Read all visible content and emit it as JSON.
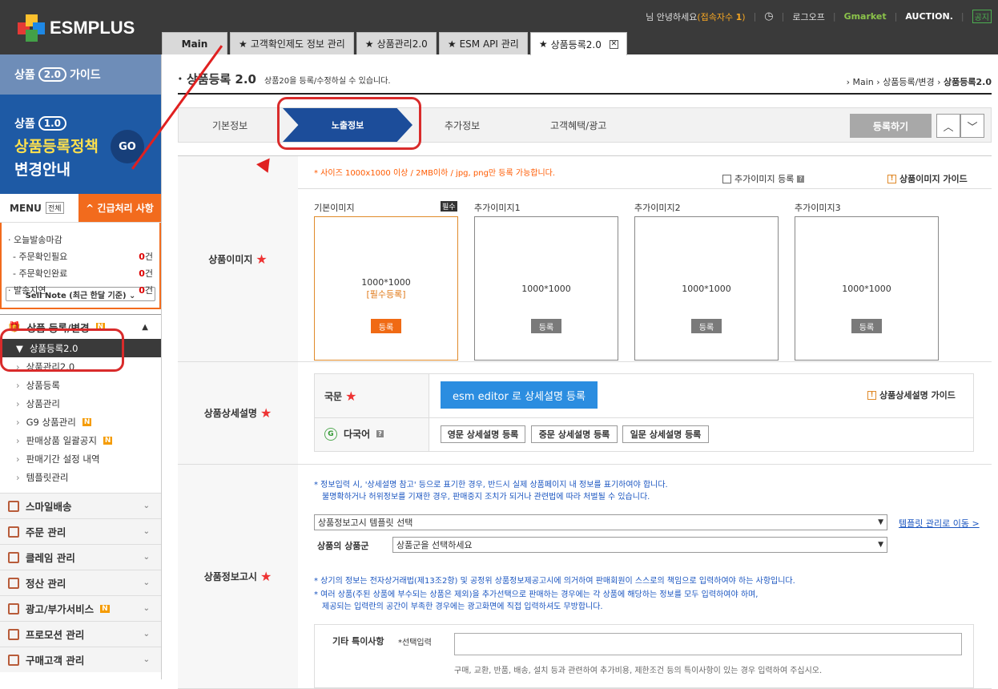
{
  "topbar": {
    "logo_text": "ESMPLUS",
    "greeting": "님 안녕하세요",
    "conn_label": "(접속자수",
    "conn_count": "1",
    "conn_close": ")",
    "logout": "로그오프",
    "gmarket": "Gmarket",
    "auction": "AUCTION.",
    "notice": "공지"
  },
  "tabs": [
    {
      "label": "Main"
    },
    {
      "label": "고객확인제도 정보 관리"
    },
    {
      "label": "상품관리2.0"
    },
    {
      "label": "ESM API 관리"
    },
    {
      "label": "상품등록2.0"
    }
  ],
  "sidebar": {
    "guide_prefix": "상품",
    "guide_version": "2.0",
    "guide_suffix": "가이드",
    "policy_prefix": "상품",
    "policy_version": "1.0",
    "policy_line2": "상품등록정책",
    "policy_line3": "변경안내",
    "go": "GO",
    "menu": "MENU",
    "all": "전체",
    "urgent": "^ 긴급처리 사항",
    "stats": [
      {
        "label": "· 오늘발송마감",
        "value": "",
        "unit": ""
      },
      {
        "label": "  - 주문확인필요",
        "value": "0",
        "unit": "건"
      },
      {
        "label": "  - 주문확인완료",
        "value": "0",
        "unit": "건"
      },
      {
        "label": "· 발송지연",
        "value": "0",
        "unit": "건"
      }
    ],
    "sellnote": "Sell Note (최근 한달 기준) ⌄",
    "section_title": "상품 등록/변경",
    "new_badge": "N",
    "items": [
      {
        "label": "상품등록2.0"
      },
      {
        "label": "상품관리2.0"
      },
      {
        "label": "상품등록"
      },
      {
        "label": "상품관리"
      },
      {
        "label": "G9 상품관리"
      },
      {
        "label": "판매상품 일괄공지"
      },
      {
        "label": "판매기간 설정 내역"
      },
      {
        "label": "템플릿관리"
      }
    ],
    "cats": [
      {
        "label": "스마일배송"
      },
      {
        "label": "주문 관리"
      },
      {
        "label": "클레임 관리"
      },
      {
        "label": "정산 관리"
      },
      {
        "label": "광고/부가서비스"
      },
      {
        "label": "프로모션 관리"
      },
      {
        "label": "구매고객 관리"
      }
    ]
  },
  "page": {
    "title": "상품등록 2.0",
    "desc": "상품20을 등록/수정하실 수 있습니다.",
    "bread1": "Main",
    "bread2": "상품등록/변경",
    "bread3": "상품등록2.0",
    "steps": [
      "기본정보",
      "노출정보",
      "추가정보",
      "고객혜택/광고"
    ],
    "register": "등록하기"
  },
  "image_section": {
    "label": "상품이미지",
    "note": "* 사이즈 1000x1000 이상 / 2MB이하 / jpg, png만 등록 가능합니다.",
    "add_check": "추가이미지 등록",
    "guide": "상품이미지 가이드",
    "boxes": [
      {
        "title": "기본이미지",
        "size": "1000*1000",
        "req": "[필수등록]",
        "btn": "등록",
        "badge": "필수"
      },
      {
        "title": "추가이미지1",
        "size": "1000*1000",
        "btn": "등록"
      },
      {
        "title": "추가이미지2",
        "size": "1000*1000",
        "btn": "등록"
      },
      {
        "title": "추가이미지3",
        "size": "1000*1000",
        "btn": "등록"
      }
    ]
  },
  "detail_section": {
    "label": "상품상세설명",
    "domestic": "국문",
    "editor_btn": "esm editor 로 상세설명 등록",
    "guide": "상품상세설명 가이드",
    "multi": "다국어",
    "en": "영문 상세설명 등록",
    "cn": "중문 상세설명 등록",
    "jp": "일문 상세설명 등록"
  },
  "notice_section": {
    "label": "상품정보고시",
    "note1": "* 정보입력 시, '상세설명 참고' 등으로 표기한 경우, 반드시 실제 상품페이지 내 정보를 표기하여야 합니다.",
    "note2": "불명확하거나 허위정보를 기재한 경우, 판매중지 조치가 되거나 관련법에 따라 처벌될 수 있습니다.",
    "template_select": "상품정보고시 템플릿 선택",
    "template_link": "템플릿 관리로 이동 >",
    "group_label": "상품의 상품군",
    "group_select": "상품군을 선택하세요",
    "note3": "* 상기의 정보는 전자상거래법(제13조2항) 및 공정위 상품정보제공고시에 의거하여 판매회원이 스스로의 책임으로 입력하여야 하는 사항입니다.",
    "note4": "* 여러 상품(주된 상품에 부수되는 상품은 제외)을 추가선택으로 판매하는 경우에는 각 상품에 해당하는 정보를 모두 입력하여야 하며,",
    "note5": "제공되는 입력란의 공간이 부족한 경우에는 광고화면에 직접 입력하셔도 무방합니다.",
    "etc_label": "기타 특이사항",
    "etc_opt": "*선택입력",
    "etc_hint": "구매, 교환, 반품, 배송, 설치 등과 관련하여 추가비용, 제한조건 등의 특이사항이 있는 경우 입력하여 주십시오."
  }
}
